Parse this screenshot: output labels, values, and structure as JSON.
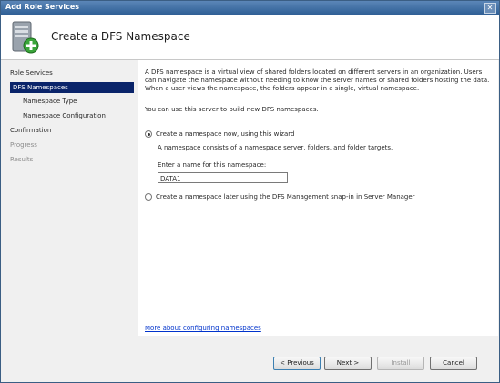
{
  "window": {
    "title": "Add Role Services",
    "close_glyph": "✕"
  },
  "header": {
    "title": "Create a DFS Namespace",
    "icon": "server-add-icon"
  },
  "nav": {
    "items": [
      {
        "label": "Role Services"
      },
      {
        "label": "DFS Namespaces"
      },
      {
        "label": "Namespace Type"
      },
      {
        "label": "Namespace Configuration"
      },
      {
        "label": "Confirmation"
      },
      {
        "label": "Progress"
      },
      {
        "label": "Results"
      }
    ]
  },
  "content": {
    "intro": "A DFS namespace is a virtual view of shared folders located on different servers in an organization. Users can navigate the namespace without needing to know the server names or shared folders hosting the data. When a user views the namespace, the folders appear in a single, virtual namespace.",
    "build_text": "You can use this server to build new DFS namespaces.",
    "option_now": "Create a namespace now, using this wizard",
    "option_now_desc": "A namespace consists of a namespace server, folders, and folder targets.",
    "name_label": "Enter a name for this namespace:",
    "name_value": "DATA1",
    "option_later": "Create a namespace later using the DFS Management snap-in in Server Manager",
    "more_link": "More about configuring namespaces"
  },
  "buttons": {
    "previous": "< Previous",
    "next": "Next >",
    "install": "Install",
    "cancel": "Cancel"
  },
  "colors": {
    "selection": "#0a246a",
    "titlebar": "#2f5f95",
    "link": "#0033cc"
  }
}
